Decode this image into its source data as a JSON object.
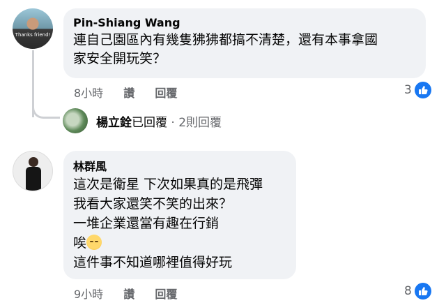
{
  "comments": [
    {
      "author": "Pin-Shiang Wang",
      "avatar_caption": "Thanks friend!",
      "lines": [
        "連自己園區內有幾隻狒狒都搞不清楚，還有本事拿國",
        "家安全開玩笑？"
      ],
      "time": "8小時",
      "like_label": "讚",
      "reply_label": "回覆",
      "reaction_count": "3",
      "reaction_icon": "thumbs-up-icon"
    },
    {
      "author": "林群風",
      "lines": [
        "這次是衛星 下次如果真的是飛彈",
        "我看大家還笑不笑的出來？",
        "一堆企業還當有趣在行銷",
        "唉",
        "這件事不知道哪裡值得好玩"
      ],
      "emoji": "pensive-face-emoji",
      "time": "9小時",
      "like_label": "讚",
      "reply_label": "回覆",
      "reaction_count": "8",
      "reaction_icon": "thumbs-up-icon"
    }
  ],
  "replies_summary": {
    "name": "楊立銓",
    "action": "已回覆",
    "separator": " · ",
    "count": "2則回覆"
  },
  "colors": {
    "bubble": "#f0f2f5",
    "meta": "#65676b",
    "like_blue": "#1877f2"
  }
}
